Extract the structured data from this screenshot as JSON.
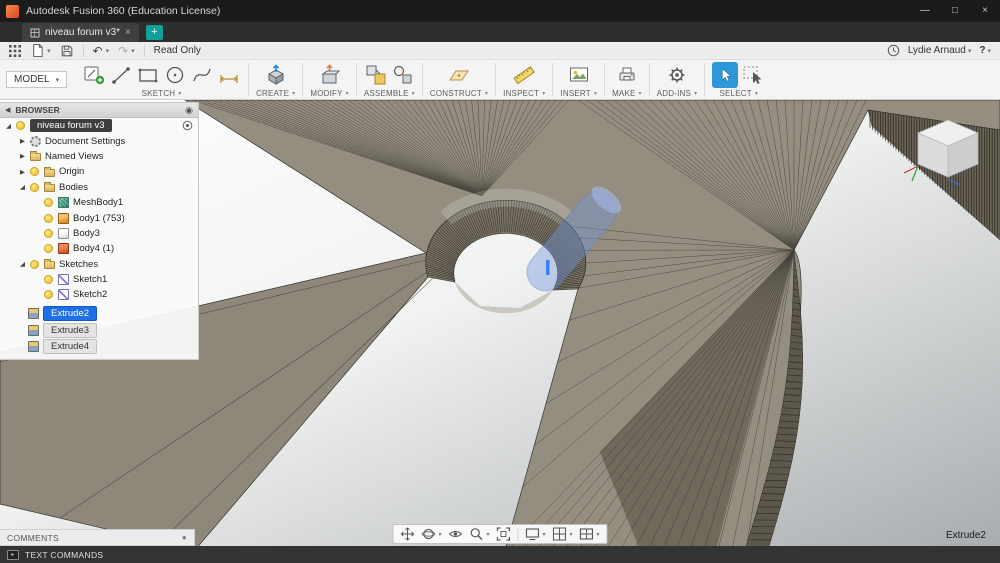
{
  "titlebar": {
    "app_title": "Autodesk Fusion 360 (Education License)",
    "minimize": "—",
    "maximize": "□",
    "close": "×"
  },
  "tabbar": {
    "document_tab": "niveau forum v3*",
    "close_tab": "×",
    "new_tab": "+"
  },
  "qat": {
    "read_only_label": "Read Only",
    "user_name": "Lydie Arnaud",
    "help_label": "?",
    "undo_glyph": "↶",
    "redo_glyph": "↷",
    "dropdown_arrow": "▾"
  },
  "ribbon": {
    "workspace_selector": "MODEL",
    "dropdown_arrow": "▾",
    "groups": [
      {
        "label": "SKETCH"
      },
      {
        "label": "CREATE"
      },
      {
        "label": "MODIFY"
      },
      {
        "label": "ASSEMBLE"
      },
      {
        "label": "CONSTRUCT"
      },
      {
        "label": "INSPECT"
      },
      {
        "label": "INSERT"
      },
      {
        "label": "MAKE"
      },
      {
        "label": "ADD-INS"
      },
      {
        "label": "SELECT"
      }
    ]
  },
  "browser": {
    "header": "BROWSER",
    "collapse_arrow": "◀",
    "options_dot": "◉",
    "expander_expanded": "◢",
    "expander_collapsed": "▶",
    "root_label": "niveau forum v3",
    "items": [
      {
        "label": "Document Settings",
        "icon": "gear",
        "expander": "collapsed",
        "bulb": false,
        "indent": 1
      },
      {
        "label": "Named Views",
        "icon": "folder",
        "expander": "collapsed",
        "bulb": false,
        "indent": 1
      },
      {
        "label": "Origin",
        "icon": "folder",
        "expander": "collapsed",
        "bulb": true,
        "indent": 1
      },
      {
        "label": "Bodies",
        "icon": "folder",
        "expander": "expanded",
        "bulb": true,
        "indent": 1
      },
      {
        "label": "MeshBody1",
        "icon": "mesh",
        "bulb": true,
        "indent": 2
      },
      {
        "label": "Body1 (753)",
        "icon": "body-orange",
        "bulb": true,
        "indent": 2
      },
      {
        "label": "Body3",
        "icon": "body-gray",
        "bulb": true,
        "indent": 2
      },
      {
        "label": "Body4 (1)",
        "icon": "body-red",
        "bulb": true,
        "indent": 2
      },
      {
        "label": "Sketches",
        "icon": "folder",
        "expander": "expanded",
        "bulb": true,
        "indent": 1
      },
      {
        "label": "Sketch1",
        "icon": "sketch",
        "bulb": true,
        "indent": 2
      },
      {
        "label": "Sketch2",
        "icon": "sketch",
        "bulb": true,
        "indent": 2
      }
    ]
  },
  "features": [
    {
      "label": "Extrude2",
      "selected": true
    },
    {
      "label": "Extrude3",
      "selected": false
    },
    {
      "label": "Extrude4",
      "selected": false
    }
  ],
  "viewport": {
    "active_feature_label": "Extrude2"
  },
  "comments": {
    "header": "COMMENTS",
    "options_dot": "●"
  },
  "statusbar": {
    "label": "TEXT COMMANDS"
  },
  "colors": {
    "accent_blue": "#0696d7",
    "selection_blue": "#1e6fe8",
    "new_tab_teal": "#0ea099",
    "model_surface": "#948e80",
    "model_wall": "#6a6457"
  }
}
